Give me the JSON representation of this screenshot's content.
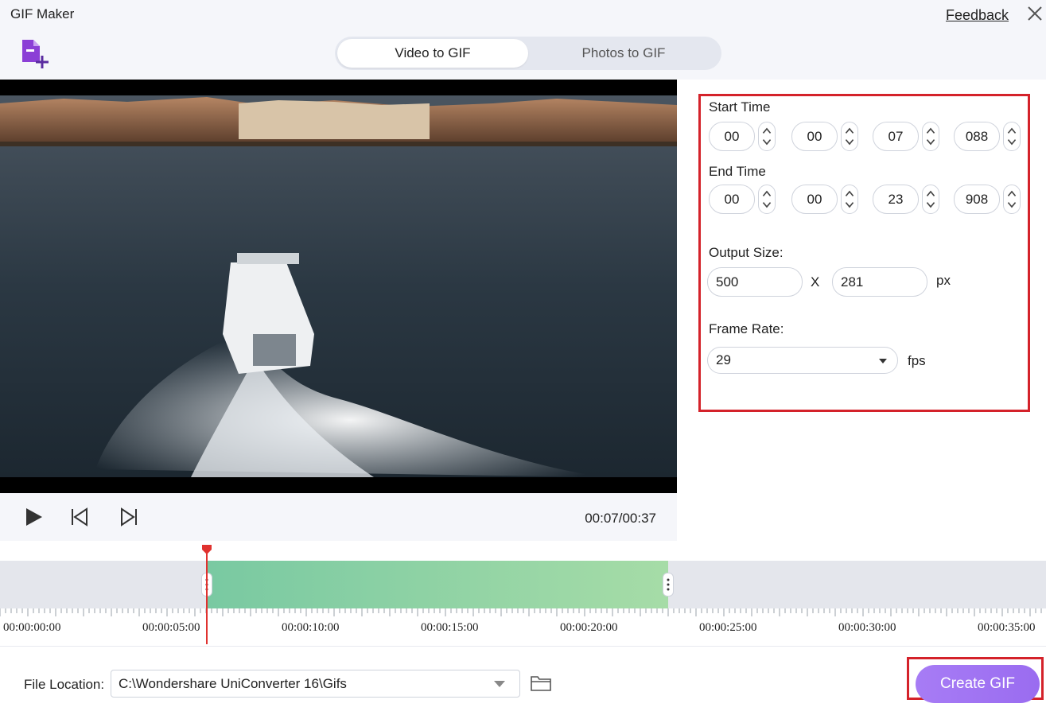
{
  "window": {
    "title": "GIF Maker",
    "feedback_label": "Feedback"
  },
  "tabs": [
    {
      "label": "Video to GIF",
      "active": true
    },
    {
      "label": "Photos to GIF",
      "active": false
    }
  ],
  "player": {
    "time": "00:07/00:37"
  },
  "settings": {
    "start_time_label": "Start Time",
    "start_time": [
      "00",
      "00",
      "07",
      "088"
    ],
    "end_time_label": "End Time",
    "end_time": [
      "00",
      "00",
      "23",
      "908"
    ],
    "output_size_label": "Output Size:",
    "width": "500",
    "separator": "X",
    "height": "281",
    "size_unit": "px",
    "frame_rate_label": "Frame Rate:",
    "frame_rate": "29",
    "frame_rate_unit": "fps"
  },
  "timeline": {
    "ticks": [
      "00:00:00:00",
      "00:00:05:00",
      "00:00:10:00",
      "00:00:15:00",
      "00:00:20:00",
      "00:00:25:00",
      "00:00:30:00",
      "00:00:35:00"
    ],
    "clip_start_seconds": 7.088,
    "clip_end_seconds": 23.908,
    "playhead_seconds": 7
  },
  "file_location": {
    "label": "File Location:",
    "path": "C:\\Wondershare UniConverter 16\\Gifs"
  },
  "actions": {
    "create_label": "Create GIF"
  },
  "colors": {
    "accent": "#9a6cf0",
    "highlight": "#d4222a",
    "playhead": "#e0322f",
    "clip": "#8fd3a5"
  },
  "icons": [
    "add-file-icon",
    "close-icon",
    "play-icon",
    "previous-frame-icon",
    "next-frame-icon",
    "folder-icon",
    "chevron-down-icon"
  ]
}
